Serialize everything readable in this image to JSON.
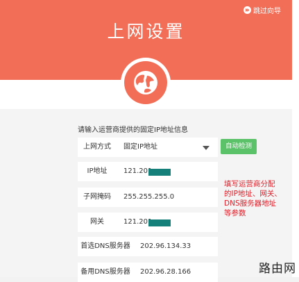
{
  "header": {
    "title": "上网设置",
    "skip_label": "跳过向导",
    "accent": "#f36e57"
  },
  "form": {
    "hint": "请输入运营商提供的固定IP地址信息",
    "connection_type": {
      "label": "上网方式",
      "value": "固定IP地址"
    },
    "ip_address": {
      "label": "IP地址",
      "value": "121.201"
    },
    "subnet_mask": {
      "label": "子网掩码",
      "value": "255.255.255.0"
    },
    "gateway": {
      "label": "网关",
      "value": "121.201"
    },
    "primary_dns": {
      "label": "首选DNS服务器",
      "value": "202.96.134.33"
    },
    "secondary_dns": {
      "label": "备用DNS服务器",
      "value": "202.96.28.166"
    },
    "auto_detect_label": "自动检测"
  },
  "annotation": {
    "lines": [
      "填写运营商分配",
      "的IP地址、网关、",
      "DNS服务器地址",
      "等参数"
    ],
    "color": "#e0202a"
  },
  "watermark": "路由网",
  "icons": {
    "skip": "skip-icon",
    "globe": "globe-icon",
    "dropdown": "chevron-down-icon"
  }
}
